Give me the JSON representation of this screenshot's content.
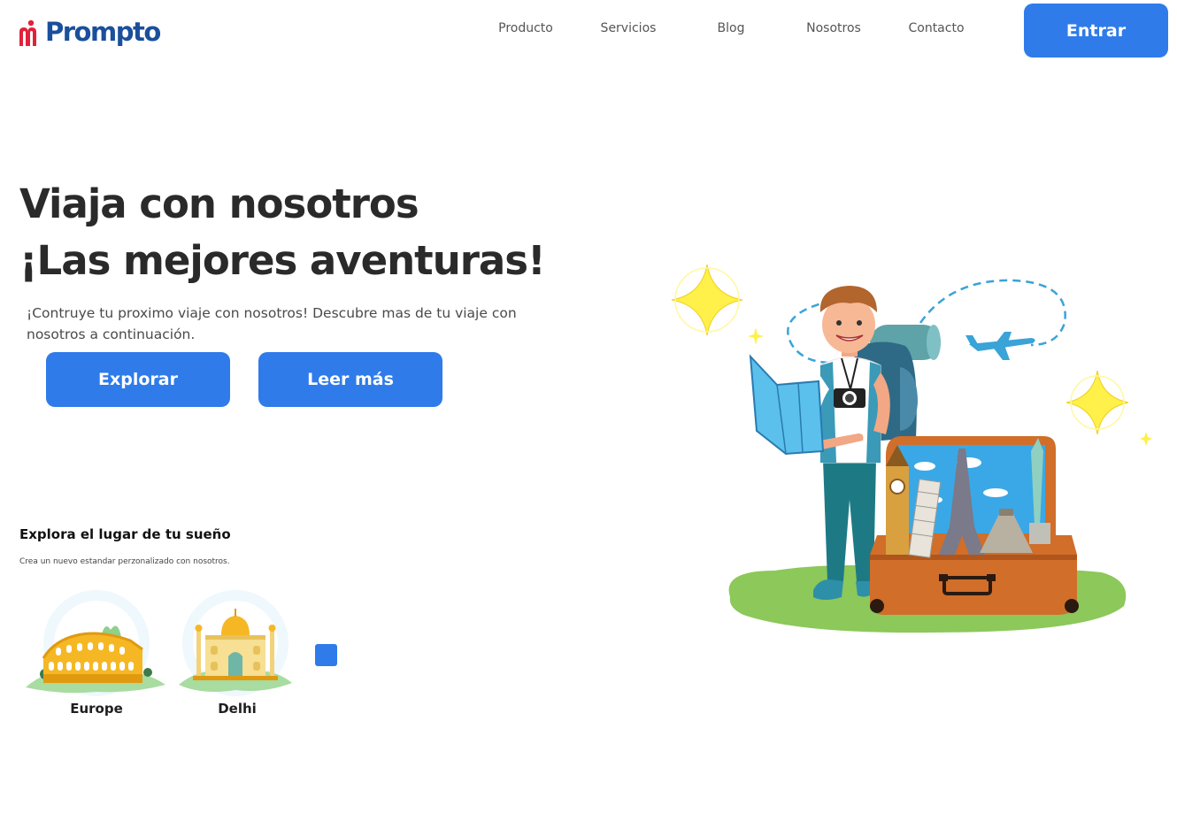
{
  "header": {
    "logo_text": "Prompto",
    "nav": [
      {
        "label": "Producto"
      },
      {
        "label": "Servicios"
      },
      {
        "label": "Blog"
      },
      {
        "label": "Nosotros"
      },
      {
        "label": "Contacto"
      }
    ],
    "login_label": "Entrar"
  },
  "hero": {
    "title_line1": "Viaja con nosotros",
    "title_line2": "¡Las mejores aventuras!",
    "subtitle": "¡Contruye tu proximo viaje con nosotros! Descubre mas de tu viaje con nosotros a continuación.",
    "explore_label": "Explorar",
    "read_more_label": "Leer más"
  },
  "explore": {
    "title": "Explora el lugar de tu sueño",
    "subtitle": "Crea un nuevo estandar perzonalizado con nosotros.",
    "places": [
      {
        "label": "Europe",
        "icon": "colosseum-icon"
      },
      {
        "label": "Delhi",
        "icon": "taj-mahal-icon"
      }
    ],
    "next_icon": "next-square-icon"
  },
  "colors": {
    "primary": "#2f7bea",
    "logo_blue": "#1a4f9c",
    "logo_red": "#e0223a",
    "title": "#2a2a2a",
    "grass": "#8cc85a"
  },
  "illustration": {
    "icon": "traveler-with-suitcase-illustration"
  }
}
